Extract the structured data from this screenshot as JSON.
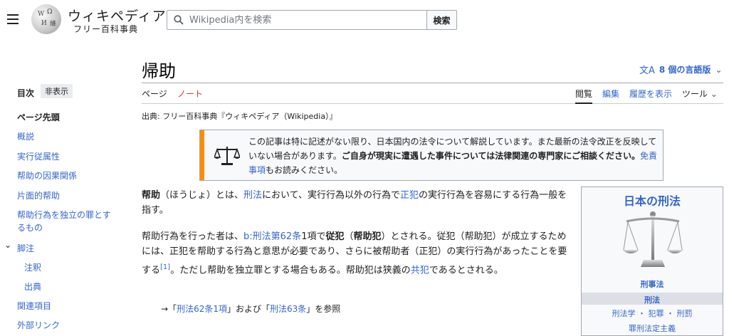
{
  "header": {
    "logo_title": "ウィキペディア",
    "logo_tagline": "フリー百科事典",
    "search_placeholder": "Wikipedia内を検索",
    "search_button": "検索"
  },
  "page": {
    "title": "帰助",
    "languages": "8 個の言語版",
    "tabs": {
      "page": "ページ",
      "note": "ノート"
    },
    "actions": {
      "read": "閲覧",
      "edit": "編集",
      "history": "履歴を表示",
      "tools": "ツール"
    },
    "from": "出典: フリー百科事典『ウィキペディア（Wikipedia）』"
  },
  "toc": {
    "heading": "目次",
    "hide": "非表示",
    "items": [
      "ページ先頭",
      "概説",
      "実行従属性",
      "帮助の因果関係",
      "片面的帮助",
      "帮助行為を独立の罪とするもの",
      "脚注",
      "注釈",
      "出典",
      "関連項目",
      "外部リンク"
    ]
  },
  "notice": {
    "part1": "この記事は特に記述がない限り、日本国内の法令について解説しています。また最新の法令改正を反映していない場合があります。",
    "bold": "ご自身が現実に遭遇した事件については法律関連の専門家にご相談ください。",
    "link": "免責事項",
    "part2": "もお読みください。"
  },
  "body": {
    "p1": {
      "bold": "帮助",
      "t1": "（ほうじょ）とは、",
      "l1": "刑法",
      "t2": "において、実行行為以外の行為で",
      "l2": "正犯",
      "t3": "の実行行為を容易にする行為一般を指す。"
    },
    "p2": {
      "t1": "帮助行為を行った者は、",
      "l1": "b:刑法第62条",
      "t2": "1項で",
      "b1": "従犯",
      "t3": "（",
      "b2": "帮助犯",
      "t4": "）とされる。従犯（帮助犯）が成立するためには、正犯を帮助する行為と意思が必要であり、さらに被帮助者（正犯）の実行行為があったことを要する",
      "ref": "[1]",
      "t5": "。ただし帮助を独立罪とする場合もある。帮助犯は狭義の",
      "l2": "共犯",
      "t6": "であるとされる。"
    },
    "see": {
      "arrow": "→「",
      "l1": "刑法62条1項",
      "mid": "」および「",
      "l2": "刑法63条",
      "end": "」を参照"
    }
  },
  "infobox": {
    "title": "日本の刑法",
    "items": [
      "刑事法",
      "刑法",
      "刑法学 ・ 犯罪 ・ 刑罰",
      "罪刑法定主義"
    ]
  }
}
